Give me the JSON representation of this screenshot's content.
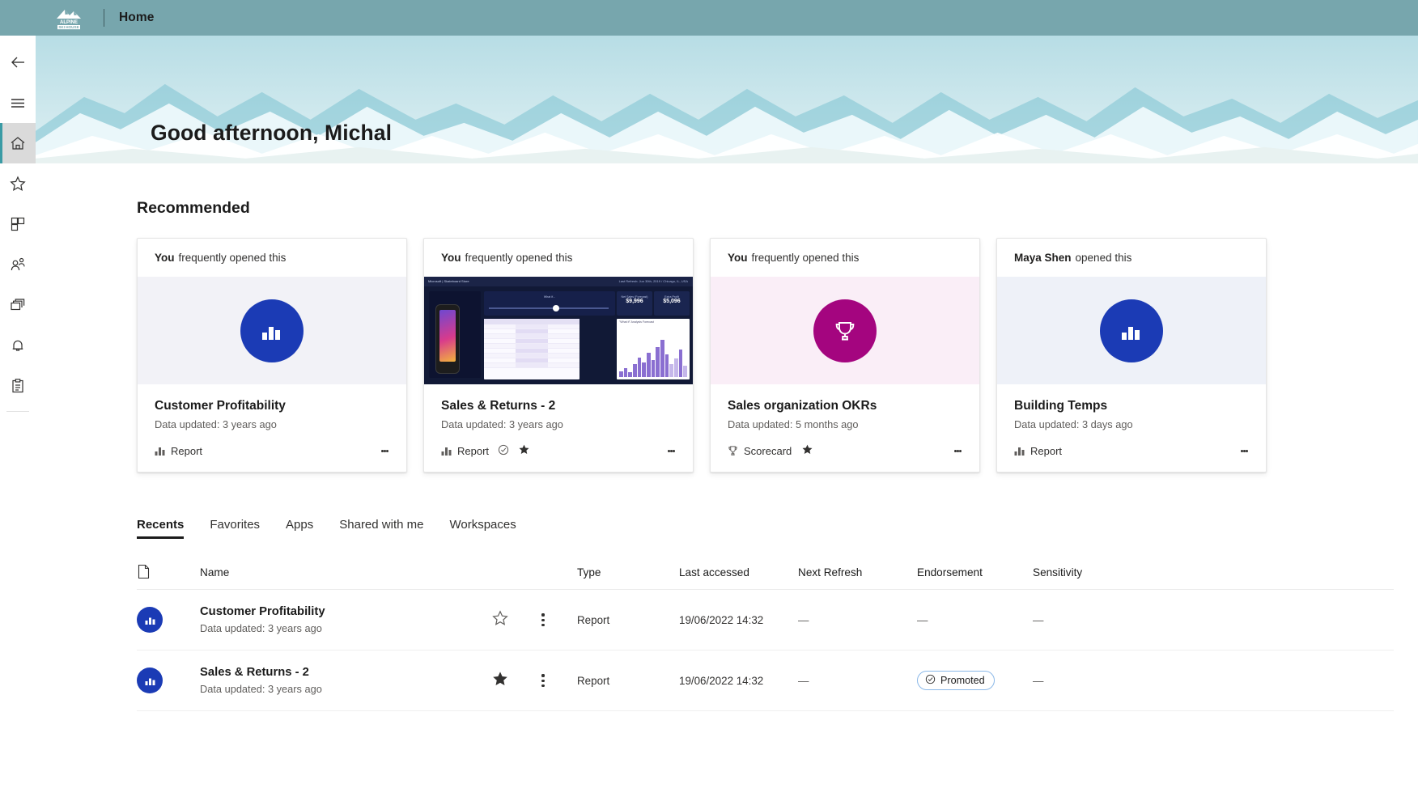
{
  "topbar": {
    "brand_line1": "ALPINE",
    "brand_line2": "SKI HOUSE",
    "title": "Home"
  },
  "rail": {
    "items": [
      {
        "name": "back",
        "icon": "back-arrow-icon",
        "selected": false
      },
      {
        "name": "menu",
        "icon": "hamburger-menu-icon",
        "selected": false
      },
      {
        "name": "home",
        "icon": "home-icon",
        "selected": true
      },
      {
        "name": "favorites",
        "icon": "star-icon",
        "selected": false
      },
      {
        "name": "apps",
        "icon": "apps-grid-icon",
        "selected": false
      },
      {
        "name": "shared-with-me",
        "icon": "people-icon",
        "selected": false
      },
      {
        "name": "workspaces",
        "icon": "workspaces-stack-icon",
        "selected": false
      },
      {
        "name": "notifications",
        "icon": "bell-icon",
        "selected": false
      },
      {
        "name": "metrics",
        "icon": "clipboard-icon",
        "selected": false
      }
    ]
  },
  "hero": {
    "greeting": "Good afternoon, Michal"
  },
  "recommended": {
    "title": "Recommended",
    "cards": [
      {
        "actor": "You",
        "action": "frequently opened this",
        "thumb_type": "icon",
        "thumb_bg": "#f2f2f7",
        "circle_color": "#1b3bb5",
        "circle_icon": "bar-chart-icon",
        "title": "Customer Profitability",
        "subtitle": "Data updated: 3 years ago",
        "type_label": "Report",
        "type_icon": "bar-chart-icon",
        "endorsed": false,
        "favorite": false
      },
      {
        "actor": "You",
        "action": "frequently opened this",
        "thumb_type": "screenshot",
        "thumb_bg": "#111936",
        "shot": {
          "app_label": "Microsoft | Skateboard Store",
          "meta_label": "Last Refresh: Jun 30th, 2019 / Chicago, IL, USA",
          "filter_title": "What if...",
          "sales_forecast_label": "Net Sales (Forecast)",
          "sales_forecast_value": "$9,996",
          "extra_profit_label": "Extra Profit",
          "extra_profit_value": "$5,096",
          "table_title": "Net Sales on \"What if\" Analysis",
          "chart_title": "\"What if\" Analysis Forecast"
        },
        "title": "Sales & Returns  - 2",
        "subtitle": "Data updated: 3 years ago",
        "type_label": "Report",
        "type_icon": "bar-chart-icon",
        "endorsed": true,
        "favorite": true
      },
      {
        "actor": "You",
        "action": "frequently opened this",
        "thumb_type": "icon",
        "thumb_bg": "#faeef7",
        "circle_color": "#a4057f",
        "circle_icon": "trophy-icon",
        "title": "Sales organization OKRs",
        "subtitle": "Data updated: 5 months ago",
        "type_label": "Scorecard",
        "type_icon": "trophy-icon",
        "endorsed": false,
        "favorite": true
      },
      {
        "actor": "Maya Shen",
        "action": "opened this",
        "thumb_type": "icon",
        "thumb_bg": "#eef1f8",
        "circle_color": "#1b3bb5",
        "circle_icon": "bar-chart-icon",
        "title": "Building Temps",
        "subtitle": "Data updated: 3 days ago",
        "type_label": "Report",
        "type_icon": "bar-chart-icon",
        "endorsed": false,
        "favorite": false
      }
    ]
  },
  "tabs": [
    {
      "label": "Recents",
      "active": true
    },
    {
      "label": "Favorites",
      "active": false
    },
    {
      "label": "Apps",
      "active": false
    },
    {
      "label": "Shared with me",
      "active": false
    },
    {
      "label": "Workspaces",
      "active": false
    }
  ],
  "table": {
    "headers": {
      "icon": "",
      "name": "Name",
      "type": "Type",
      "last_accessed": "Last accessed",
      "next_refresh": "Next Refresh",
      "endorsement": "Endorsement",
      "sensitivity": "Sensitivity"
    },
    "rows": [
      {
        "name": "Customer Profitability",
        "sub": "Data updated: 3 years ago",
        "favorite": false,
        "type": "Report",
        "last_accessed": "19/06/2022 14:32",
        "next_refresh": "—",
        "endorsement": "—",
        "endorsement_badge": null,
        "sensitivity": "—"
      },
      {
        "name": "Sales & Returns  - 2",
        "sub": "Data updated: 3 years ago",
        "favorite": true,
        "type": "Report",
        "last_accessed": "19/06/2022 14:32",
        "next_refresh": "—",
        "endorsement": "",
        "endorsement_badge": "Promoted",
        "sensitivity": "—"
      }
    ]
  },
  "colors": {
    "topbar": "#77a6ad",
    "accent_blue": "#1b3bb5",
    "accent_magenta": "#a4057f",
    "rail_selected": "#dadada",
    "rail_indicator": "#3a9ba5"
  }
}
